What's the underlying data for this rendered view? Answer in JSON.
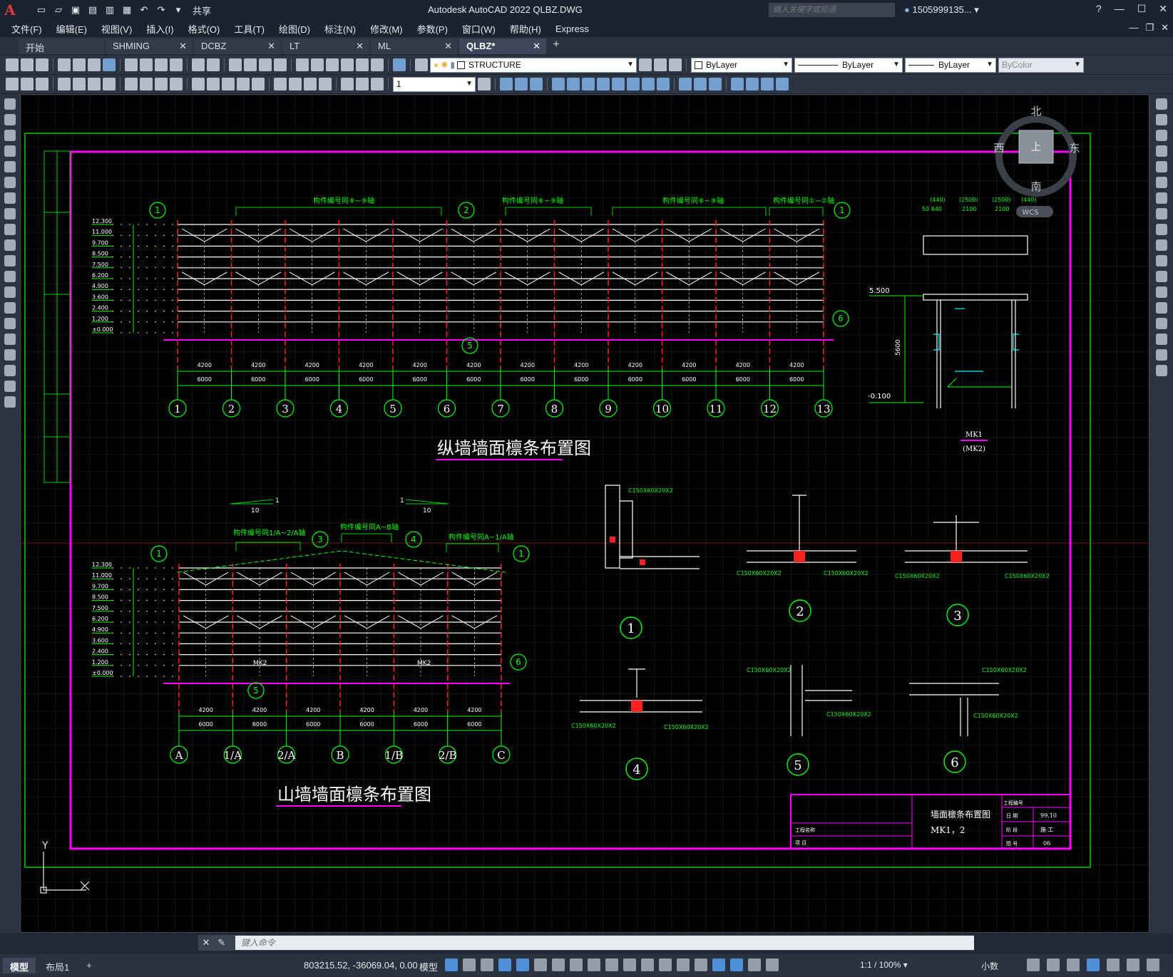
{
  "app": {
    "logo_letter": "A",
    "title": "Autodesk AutoCAD 2022    QLBZ.DWG",
    "share_label": "共享",
    "search_placeholder": "键入关键字或短语",
    "user": "1505999135... ▾"
  },
  "menu": [
    "文件(F)",
    "编辑(E)",
    "视图(V)",
    "插入(I)",
    "格式(O)",
    "工具(T)",
    "绘图(D)",
    "标注(N)",
    "修改(M)",
    "参数(P)",
    "窗口(W)",
    "帮助(H)",
    "Express"
  ],
  "tabs": [
    {
      "label": "开始"
    },
    {
      "label": "SHMING"
    },
    {
      "label": "DCBZ"
    },
    {
      "label": "LT"
    },
    {
      "label": "ML"
    },
    {
      "label": "QLBZ*"
    }
  ],
  "toolbar": {
    "layer": "STRUCTURE",
    "color": "ByLayer",
    "linetype": "ByLayer",
    "lineweight": "ByLayer",
    "plotstyle": "ByColor",
    "dimscale": "1"
  },
  "viewcube": {
    "north": "北",
    "south": "南",
    "west": "西",
    "east": "东",
    "face": "上",
    "wcs": "WCS"
  },
  "drawing": {
    "title_main": "纵墙墙面檩条布置图",
    "title_gable": "山墙墙面檩条布置图",
    "section_label_main": [
      "构件编号同⑧~⑨轴",
      "构件编号同⑧~⑨轴",
      "构件编号同⑧~⑨轴",
      "构件编号同①~②轴"
    ],
    "section_label_gable": [
      "构件编号同1/A~2/A轴",
      "构件编号同A~B轴",
      "构件编号同A~1/A轴"
    ],
    "axes_main": [
      "1",
      "2",
      "3",
      "4",
      "5",
      "6",
      "7",
      "8",
      "9",
      "10",
      "11",
      "12",
      "13"
    ],
    "axes_gable": [
      "A",
      "1/A",
      "2/A",
      "B",
      "1/B",
      "2/B",
      "C"
    ],
    "elevations": [
      "12.300",
      "11.000",
      "9.700",
      "8.500",
      "7.500",
      "6.200",
      "4.900",
      "3.600",
      "2.400",
      "1.200",
      "±0.000"
    ],
    "mk_label": "MK1",
    "mk_label2": "(MK2)",
    "door_elev_top": "5.500",
    "door_elev_bot": "-0.100",
    "detail_numbers": [
      "1",
      "2",
      "3",
      "4",
      "5",
      "6"
    ],
    "titleblock": {
      "drawing_name": "墙面檩条布置图",
      "sub_name": "MK1，2",
      "date_label": "日 期",
      "date": "99.10",
      "design_no": "工程编号",
      "sheet_label": "图 号",
      "sheet": "06",
      "stage_label": "阶 段",
      "stage": "施 工",
      "project_label": "工程名称",
      "item_label": "项 目"
    }
  },
  "command": {
    "placeholder": "键入命令"
  },
  "status": {
    "layout_tabs": [
      "模型",
      "布局1"
    ],
    "coords": "803215.52, -36069.04, 0.00",
    "model": "模型",
    "scale": "1:1 / 100% ▾",
    "units": "小数"
  },
  "colors": {
    "green": "#00ff00",
    "magenta": "#ff00ff",
    "white": "#ffffff",
    "red": "#ff2020",
    "cyan": "#00ffff",
    "yellow": "#ffff00"
  }
}
